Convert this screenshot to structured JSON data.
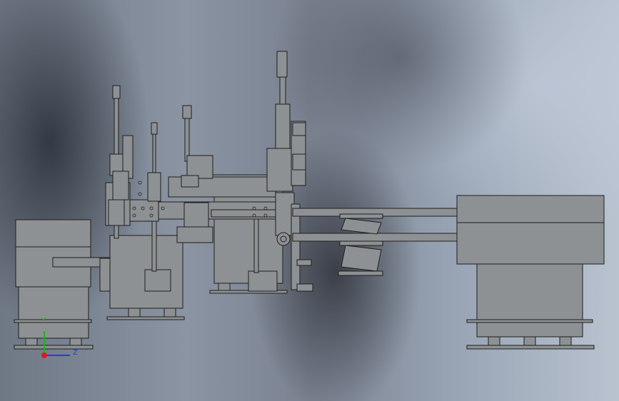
{
  "viewport": {
    "background_colors": [
      "#6f7885",
      "#8a94a2",
      "#b9c3d0"
    ],
    "part_fill": "#8e9193",
    "part_stroke": "#1e1e1e"
  },
  "triad": {
    "y_label": "Y",
    "z_label": "Z",
    "y_color": "#1fb21f",
    "z_color": "#1f3fd6",
    "x_color": "#d21f1f"
  }
}
